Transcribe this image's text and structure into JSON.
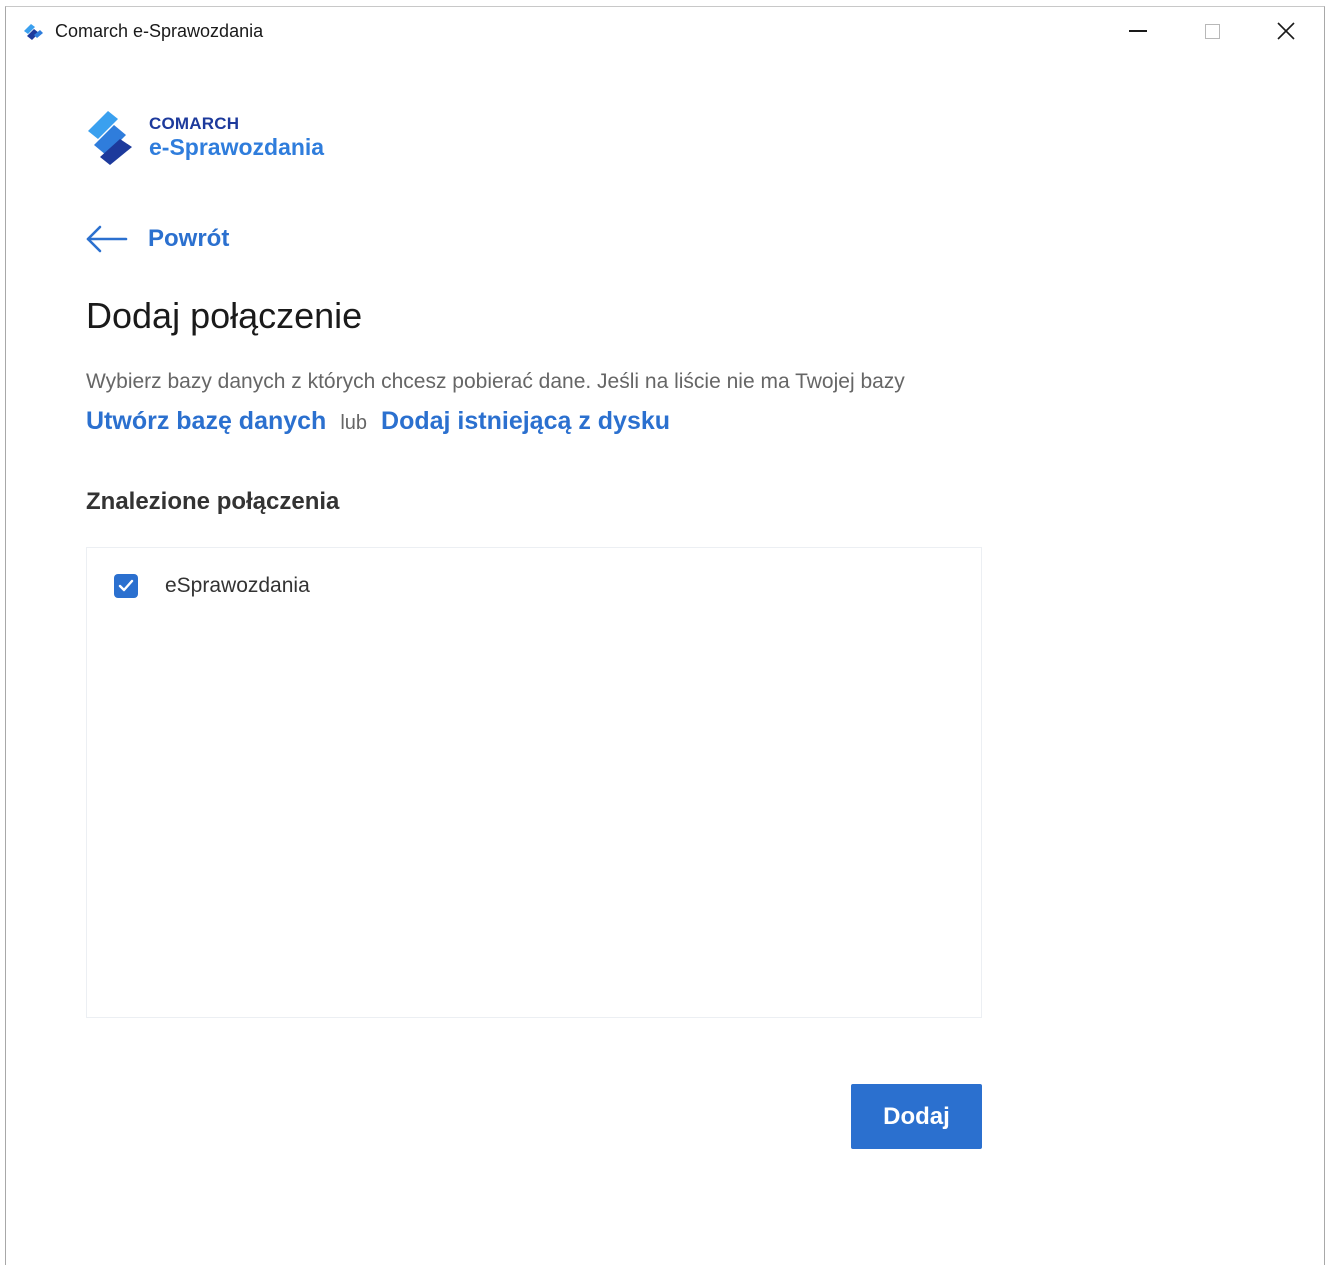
{
  "window": {
    "title": "Comarch e-Sprawozdania"
  },
  "logo": {
    "brand": "COMARCH",
    "product": "e-Sprawozdania"
  },
  "back": {
    "label": "Powrót"
  },
  "page": {
    "title": "Dodaj połączenie",
    "description": "Wybierz bazy danych z których chcesz pobierać dane. Jeśli na liście nie ma Twojej bazy",
    "create_link": "Utwórz bazę danych",
    "or_text": "lub",
    "add_existing_link": "Dodaj istniejącą z dysku"
  },
  "connections": {
    "section_title": "Znalezione połączenia",
    "items": [
      {
        "label": "eSprawozdania",
        "checked": true
      }
    ]
  },
  "footer": {
    "add_button_label": "Dodaj"
  },
  "colors": {
    "accent": "#2b70cf",
    "brand_dark": "#1d3a9c",
    "text_muted": "#666666"
  }
}
